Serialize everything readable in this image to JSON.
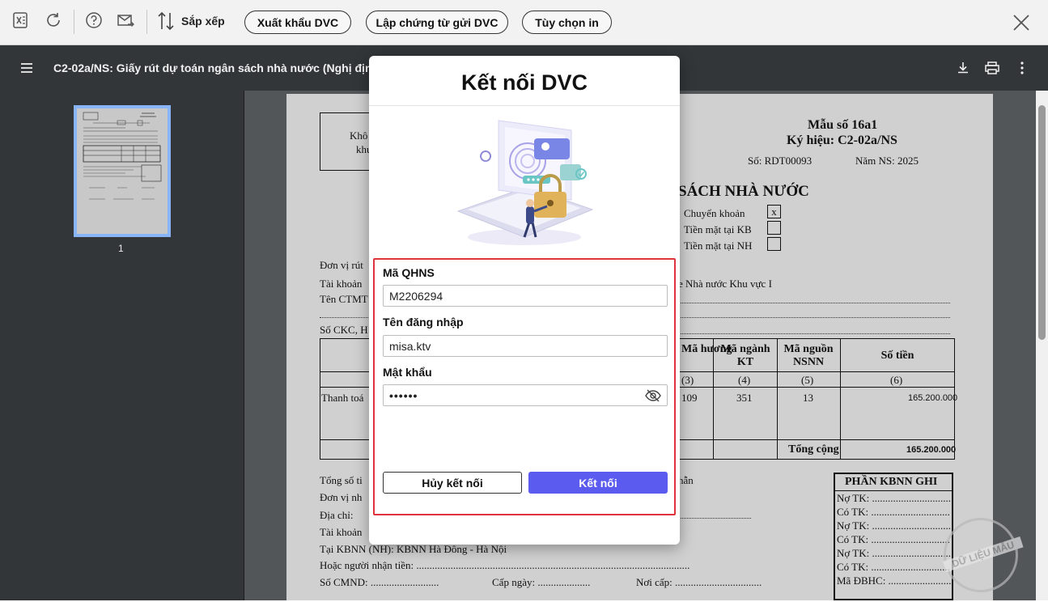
{
  "toolbar": {
    "sort_label": "Sắp xếp",
    "buttons": [
      "Xuất khẩu DVC",
      "Lập chứng từ gửi DVC",
      "Tùy chọn in"
    ]
  },
  "viewer": {
    "title": "C2-02a/NS: Giấy rút dự toán ngân sách nhà nước (Nghị định 11"
  },
  "thumbnail": {
    "page_number": "1"
  },
  "document": {
    "left_box": [
      "Khô",
      "khu"
    ],
    "form_no": "Mẫu số 16a1",
    "symbol": "Ký hiệu: C2-02a/NS",
    "so": "Số: RDT00093",
    "nam": "Năm NS: 2025",
    "heading_partial": "SÁCH NHÀ NƯỚC",
    "pay_methods": [
      "Chuyển khoản",
      "Tiền mặt tại KB",
      "Tiền mặt tại NH"
    ],
    "pay_mark": "x",
    "left_lines": [
      "Đơn vị rút",
      "Tài khoản",
      "Tên CTMT",
      "Số CKC, H"
    ],
    "right_fragment": "e Nhà nước Khu vực I",
    "table": {
      "headers": [
        "Mã chương",
        "Mã ngành KT",
        "Mã nguồn NSNN",
        "Số tiền"
      ],
      "header_visible": [
        "Mã\nhương",
        "Mã ngành\nKT",
        "Mã nguồn\nNSNN",
        "Số tiền"
      ],
      "col_numbers": [
        "(3)",
        "(4)",
        "(5)",
        "(6)"
      ],
      "row_label": "Thanh toá",
      "row": [
        "109",
        "351",
        "13",
        "165.200.000"
      ],
      "total_label": "Tổng cộng",
      "total_value": "165.200.000"
    },
    "bottom_lines": [
      "Tổng số ti",
      "Đơn vị nh",
      "Địa chỉ:",
      "Tài khoản"
    ],
    "bottom_right_fragment": "hẫn",
    "kbnn_line": "Tại KBNN (NH): KBNN Hà Đông - Hà Nội",
    "receiver_line": "Hoặc người nhận tiền: ........................................................................................................",
    "cmnd": "Số CMND: ..........................",
    "cap_ngay": "Cấp ngày: ....................",
    "noi_cap": "Nơi cấp: .................................",
    "kbnn_box": {
      "title": "PHẦN KBNN GHI",
      "lines": [
        "Nợ TK: ..............................",
        "Có TK: ..............................",
        "Nợ TK: ..............................",
        "Có TK: ..............................",
        "Nợ TK: ..............................",
        "Có TK: ..............................",
        "Mã ĐBHC: ........................."
      ]
    }
  },
  "dialog": {
    "title": "Kết nối DVC",
    "fields": {
      "qhns_label": "Mã QHNS",
      "qhns_value": "M2206294",
      "user_label": "Tên đăng nhập",
      "user_value": "misa.ktv",
      "pass_label": "Mật khẩu",
      "pass_value": "••••••"
    },
    "cancel_label": "Hủy kết nối",
    "connect_label": "Kết nối",
    "accent": "#5b5bf0",
    "highlight": "#e0333d"
  },
  "watermark": "DỮ LIỆU MẪU"
}
